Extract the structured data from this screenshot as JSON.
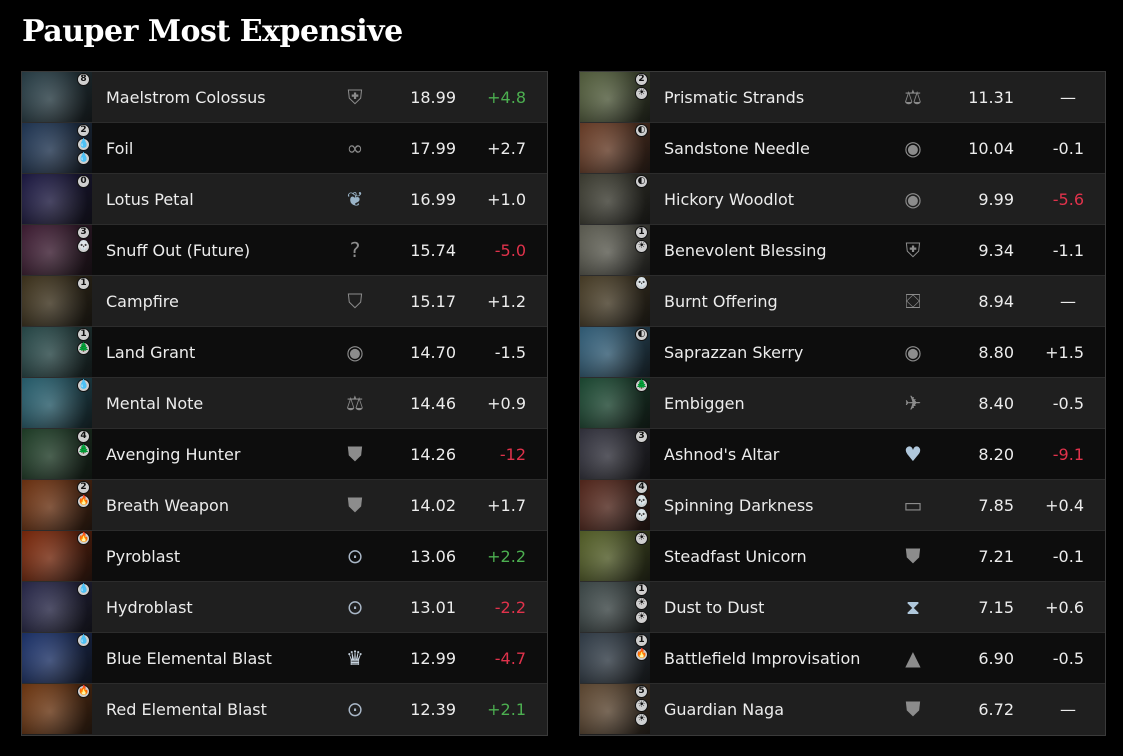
{
  "title": "Pauper Most Expensive",
  "colors": {
    "positive": "#4caf50",
    "negative": "#e0324b",
    "neutral": "#ececec"
  },
  "left": [
    {
      "name": "Maelstrom Colossus",
      "cost": [
        "8"
      ],
      "art": "#3b5a66",
      "set_icon": "guild-crest-icon",
      "price": "18.99",
      "change": "+4.8",
      "tone": "pos"
    },
    {
      "name": "Foil",
      "cost": [
        "2",
        "💧",
        "💧"
      ],
      "art": "#2f4f7a",
      "set_icon": "loop-icon",
      "price": "17.99",
      "change": "+2.7",
      "tone": "neutral"
    },
    {
      "name": "Lotus Petal",
      "cost": [
        "0"
      ],
      "art": "#2a2560",
      "set_icon": "tempest-icon",
      "price": "16.99",
      "change": "+1.0",
      "tone": "neutral"
    },
    {
      "name": "Snuff Out (Future)",
      "cost": [
        "3",
        "💀"
      ],
      "art": "#5a2a4a",
      "set_icon": "question-icon",
      "price": "15.74",
      "change": "-5.0",
      "tone": "neg"
    },
    {
      "name": "Campfire",
      "cost": [
        "1"
      ],
      "art": "#5a4a2a",
      "set_icon": "crest-icon",
      "price": "15.17",
      "change": "+1.2",
      "tone": "neutral"
    },
    {
      "name": "Land Grant",
      "cost": [
        "1",
        "🌲"
      ],
      "art": "#3a6a6a",
      "set_icon": "mask-icon",
      "price": "14.70",
      "change": "-1.5",
      "tone": "neutral"
    },
    {
      "name": "Mental Note",
      "cost": [
        "💧"
      ],
      "art": "#3a8aa0",
      "set_icon": "scales-icon",
      "price": "14.46",
      "change": "+0.9",
      "tone": "neutral"
    },
    {
      "name": "Avenging Hunter",
      "cost": [
        "4",
        "🌲"
      ],
      "art": "#2e5a3a",
      "set_icon": "shield-icon",
      "price": "14.26",
      "change": "-12",
      "tone": "neg"
    },
    {
      "name": "Breath Weapon",
      "cost": [
        "2",
        "🔥"
      ],
      "art": "#a04a1a",
      "set_icon": "shield-icon",
      "price": "14.02",
      "change": "+1.7",
      "tone": "neutral"
    },
    {
      "name": "Pyroblast",
      "cost": [
        "🔥"
      ],
      "art": "#b03a10",
      "set_icon": "eye-icon",
      "price": "13.06",
      "change": "+2.2",
      "tone": "pos"
    },
    {
      "name": "Hydroblast",
      "cost": [
        "💧"
      ],
      "art": "#3a3a6a",
      "set_icon": "eye-icon",
      "price": "13.01",
      "change": "-2.2",
      "tone": "neg"
    },
    {
      "name": "Blue Elemental Blast",
      "cost": [
        "💧"
      ],
      "art": "#2a4a9a",
      "set_icon": "anniversary-icon",
      "price": "12.99",
      "change": "-4.7",
      "tone": "neg"
    },
    {
      "name": "Red Elemental Blast",
      "cost": [
        "🔥"
      ],
      "art": "#a0501a",
      "set_icon": "eye-icon",
      "price": "12.39",
      "change": "+2.1",
      "tone": "pos"
    }
  ],
  "right": [
    {
      "name": "Prismatic Strands",
      "cost": [
        "2",
        "☀"
      ],
      "art": "#7a8a5a",
      "set_icon": "scales-icon",
      "price": "11.31",
      "change": "—",
      "tone": "flat"
    },
    {
      "name": "Sandstone Needle",
      "cost": [
        "◐"
      ],
      "art": "#9a5a3a",
      "set_icon": "mask-icon",
      "price": "10.04",
      "change": "-0.1",
      "tone": "neutral"
    },
    {
      "name": "Hickory Woodlot",
      "cost": [
        "◐"
      ],
      "art": "#5a5a4a",
      "set_icon": "mask-icon",
      "price": "9.99",
      "change": "-5.6",
      "tone": "neg"
    },
    {
      "name": "Benevolent Blessing",
      "cost": [
        "1",
        "☀"
      ],
      "art": "#8a8a7a",
      "set_icon": "guild-crest-icon",
      "price": "9.34",
      "change": "-1.1",
      "tone": "neutral"
    },
    {
      "name": "Burnt Offering",
      "cost": [
        "💀"
      ],
      "art": "#6a5a3a",
      "set_icon": "chest-icon",
      "price": "8.94",
      "change": "—",
      "tone": "flat"
    },
    {
      "name": "Saprazzan Skerry",
      "cost": [
        "◐"
      ],
      "art": "#4a8ab0",
      "set_icon": "mask-icon",
      "price": "8.80",
      "change": "+1.5",
      "tone": "neutral"
    },
    {
      "name": "Embiggen",
      "cost": [
        "🌲"
      ],
      "art": "#2a6a4a",
      "set_icon": "wing-icon",
      "price": "8.40",
      "change": "-0.5",
      "tone": "neutral"
    },
    {
      "name": "Ashnod's Altar",
      "cost": [
        "3"
      ],
      "art": "#4a4a5a",
      "set_icon": "heart-crest-icon",
      "price": "8.20",
      "change": "-9.1",
      "tone": "neg"
    },
    {
      "name": "Spinning Darkness",
      "cost": [
        "4",
        "💀",
        "💀"
      ],
      "art": "#7a3a2a",
      "set_icon": "book-icon",
      "price": "7.85",
      "change": "+0.4",
      "tone": "neutral"
    },
    {
      "name": "Steadfast Unicorn",
      "cost": [
        "☀"
      ],
      "art": "#7a8a3a",
      "set_icon": "shield-icon",
      "price": "7.21",
      "change": "-0.1",
      "tone": "neutral"
    },
    {
      "name": "Dust to Dust",
      "cost": [
        "1",
        "☀",
        "☀"
      ],
      "art": "#5a6a6a",
      "set_icon": "hourglass-icon",
      "price": "7.15",
      "change": "+0.6",
      "tone": "neutral"
    },
    {
      "name": "Battlefield Improvisation",
      "cost": [
        "1",
        "🔥"
      ],
      "art": "#4a5a6a",
      "set_icon": "assassin-icon",
      "price": "6.90",
      "change": "-0.5",
      "tone": "neutral"
    },
    {
      "name": "Guardian Naga",
      "cost": [
        "5",
        "☀",
        "☀"
      ],
      "art": "#8a6a4a",
      "set_icon": "shield-icon",
      "price": "6.72",
      "change": "—",
      "tone": "flat"
    }
  ]
}
